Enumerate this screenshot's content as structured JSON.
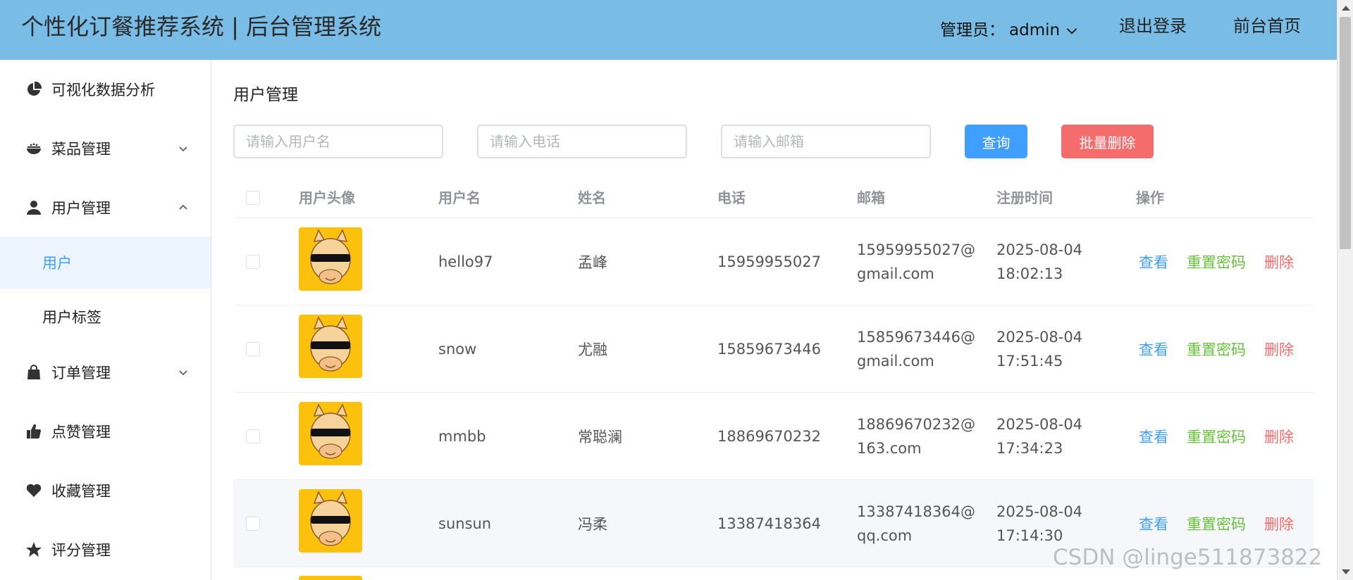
{
  "header": {
    "title": "个性化订餐推荐系统 | 后台管理系统",
    "admin_label": "管理员：",
    "admin_name": "admin",
    "logout": "退出登录",
    "home": "前台首页",
    "bg_color": "#79bde6"
  },
  "sidebar": {
    "items": [
      {
        "label": "可视化数据分析",
        "icon": "pie-chart-icon"
      },
      {
        "label": "菜品管理",
        "icon": "food-bowl-icon",
        "expandable": true
      },
      {
        "label": "用户管理",
        "icon": "user-icon",
        "expandable": true,
        "expanded": true
      },
      {
        "label": "订单管理",
        "icon": "shopping-bag-icon",
        "expandable": true
      },
      {
        "label": "点赞管理",
        "icon": "thumbs-up-icon"
      },
      {
        "label": "收藏管理",
        "icon": "heart-icon"
      },
      {
        "label": "评分管理",
        "icon": "star-icon"
      }
    ],
    "submenu": [
      {
        "label": "用户",
        "active": true
      },
      {
        "label": "用户标签"
      }
    ]
  },
  "main": {
    "title": "用户管理",
    "search": {
      "username_placeholder": "请输入用户名",
      "phone_placeholder": "请输入电话",
      "email_placeholder": "请输入邮箱",
      "query_label": "查询",
      "batch_delete_label": "批量删除"
    },
    "table": {
      "columns": [
        "用户头像",
        "用户名",
        "姓名",
        "电话",
        "邮箱",
        "注册时间",
        "操作"
      ],
      "actions": {
        "view": "查看",
        "reset": "重置密码",
        "delete": "删除"
      },
      "rows": [
        {
          "username": "hello97",
          "name": "孟峰",
          "phone": "15959955027",
          "email1": "15959955027@",
          "email2": "gmail.com",
          "date": "2025-08-04",
          "time": "18:02:13"
        },
        {
          "username": "snow",
          "name": "尤融",
          "phone": "15859673446",
          "email1": "15859673446@",
          "email2": "gmail.com",
          "date": "2025-08-04",
          "time": "17:51:45"
        },
        {
          "username": "mmbb",
          "name": "常聪澜",
          "phone": "18869670232",
          "email1": "18869670232@",
          "email2": "163.com",
          "date": "2025-08-04",
          "time": "17:34:23"
        },
        {
          "username": "sunsun",
          "name": "冯柔",
          "phone": "13387418364",
          "email1": "13387418364@",
          "email2": "qq.com",
          "date": "2025-08-04",
          "time": "17:14:30"
        }
      ]
    }
  },
  "watermark": "CSDN @linge511873822"
}
